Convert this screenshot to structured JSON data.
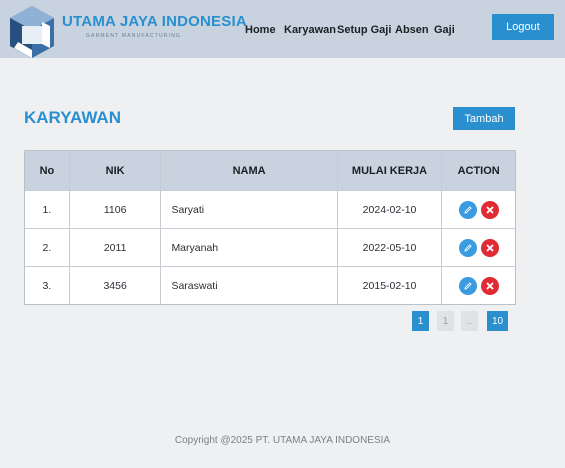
{
  "brand": {
    "name": "UTAMA JAYA INDONESIA",
    "tagline": "GARMENT MANUFACTURING"
  },
  "nav": {
    "items": [
      "Home",
      "Karyawan",
      "Setup Gaji",
      "Absen",
      "Gaji"
    ],
    "logout_label": "Logout"
  },
  "page": {
    "title": "KARYAWAN",
    "add_button_label": "Tambah"
  },
  "table": {
    "columns": [
      "No",
      "NIK",
      "NAMA",
      "MULAI KERJA",
      "ACTION"
    ],
    "rows": [
      {
        "no": "1.",
        "nik": "1106",
        "nama": "Saryati",
        "mulai_kerja": "2024-02-10"
      },
      {
        "no": "2.",
        "nik": "2011",
        "nama": "Maryanah",
        "mulai_kerja": "2022-05-10"
      },
      {
        "no": "3.",
        "nik": "3456",
        "nama": "Saraswati",
        "mulai_kerja": "2015-02-10"
      }
    ],
    "action_icons": [
      "pencil-icon",
      "close-icon"
    ]
  },
  "pagination": {
    "pages": [
      "1",
      "1",
      "..",
      "10"
    ],
    "active_index": 0
  },
  "footer": {
    "text": "Copyright @2025 PT. UTAMA JAYA INDONESIA"
  },
  "colors": {
    "accent": "#2a8fcf",
    "header_bg": "#c8d3df",
    "page_bg": "#eef0f2",
    "edit": "#3b9be0",
    "delete": "#e02b35"
  }
}
